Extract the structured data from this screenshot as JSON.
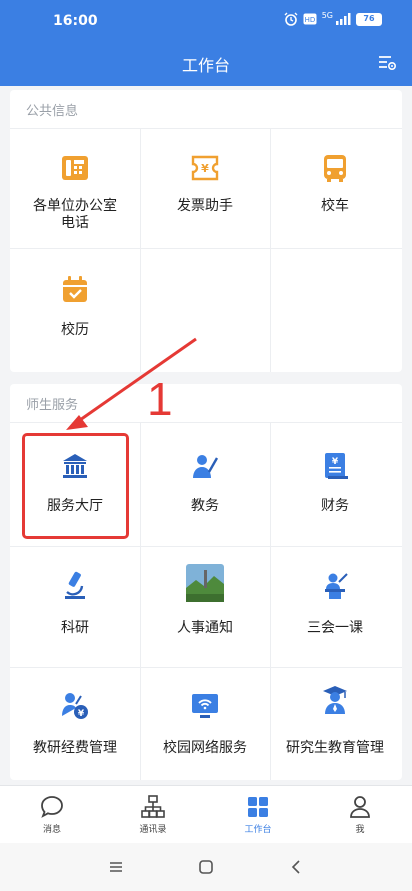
{
  "status_bar": {
    "time": "16:00",
    "network": "5G",
    "battery": "76"
  },
  "header": {
    "title": "工作台"
  },
  "public_info": {
    "section_title": "公共信息",
    "items": [
      {
        "label": "各单位办公室\n电话",
        "icon": "phone-book-icon"
      },
      {
        "label": "发票助手",
        "icon": "invoice-ticket-icon"
      },
      {
        "label": "校车",
        "icon": "bus-icon"
      },
      {
        "label": "校历",
        "icon": "calendar-icon"
      }
    ]
  },
  "services": {
    "section_title": "师生服务",
    "items": [
      {
        "label": "服务大厅",
        "icon": "bank-hall-icon"
      },
      {
        "label": "教务",
        "icon": "teacher-icon"
      },
      {
        "label": "财务",
        "icon": "finance-document-icon"
      },
      {
        "label": "科研",
        "icon": "microscope-icon"
      },
      {
        "label": "人事通知",
        "icon": "landscape-photo-icon"
      },
      {
        "label": "三会一课",
        "icon": "lecture-podium-icon"
      },
      {
        "label": "教研经费管理",
        "icon": "research-fund-icon"
      },
      {
        "label": "校园网络服务",
        "icon": "wifi-monitor-icon"
      },
      {
        "label": "研究生教育管理",
        "icon": "graduate-icon"
      }
    ]
  },
  "annotation": {
    "number": "1"
  },
  "tabbar": {
    "tabs": [
      {
        "label": "消息",
        "icon": "chat-bubble-icon"
      },
      {
        "label": "通讯录",
        "icon": "org-chart-icon"
      },
      {
        "label": "工作台",
        "icon": "grid-icon"
      },
      {
        "label": "我",
        "icon": "person-icon"
      }
    ],
    "active_index": 2
  },
  "colors": {
    "primary": "#3b7fe3",
    "orange": "#f0a030",
    "annotation_red": "#e53935"
  }
}
